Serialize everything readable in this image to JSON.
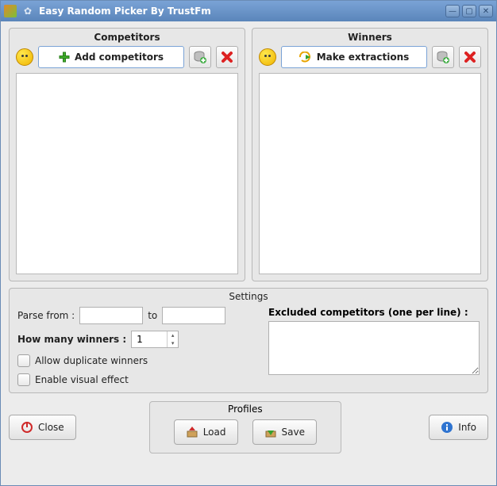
{
  "window": {
    "title": "Easy Random Picker By TrustFm"
  },
  "competitors": {
    "title": "Competitors",
    "add_label": "Add competitors"
  },
  "winners": {
    "title": "Winners",
    "extract_label": "Make extractions"
  },
  "settings": {
    "title": "Settings",
    "parse_from_label": "Parse from :",
    "parse_from_value": "",
    "to_label": "to",
    "to_value": "",
    "how_many_label": "How many winners :",
    "how_many_value": "1",
    "allow_dup_label": "Allow duplicate winners",
    "visual_effect_label": "Enable visual effect",
    "excluded_label": "Excluded competitors (one per line) :",
    "excluded_value": ""
  },
  "profiles": {
    "title": "Profiles",
    "load_label": "Load",
    "save_label": "Save"
  },
  "buttons": {
    "close_label": "Close",
    "info_label": "Info"
  }
}
